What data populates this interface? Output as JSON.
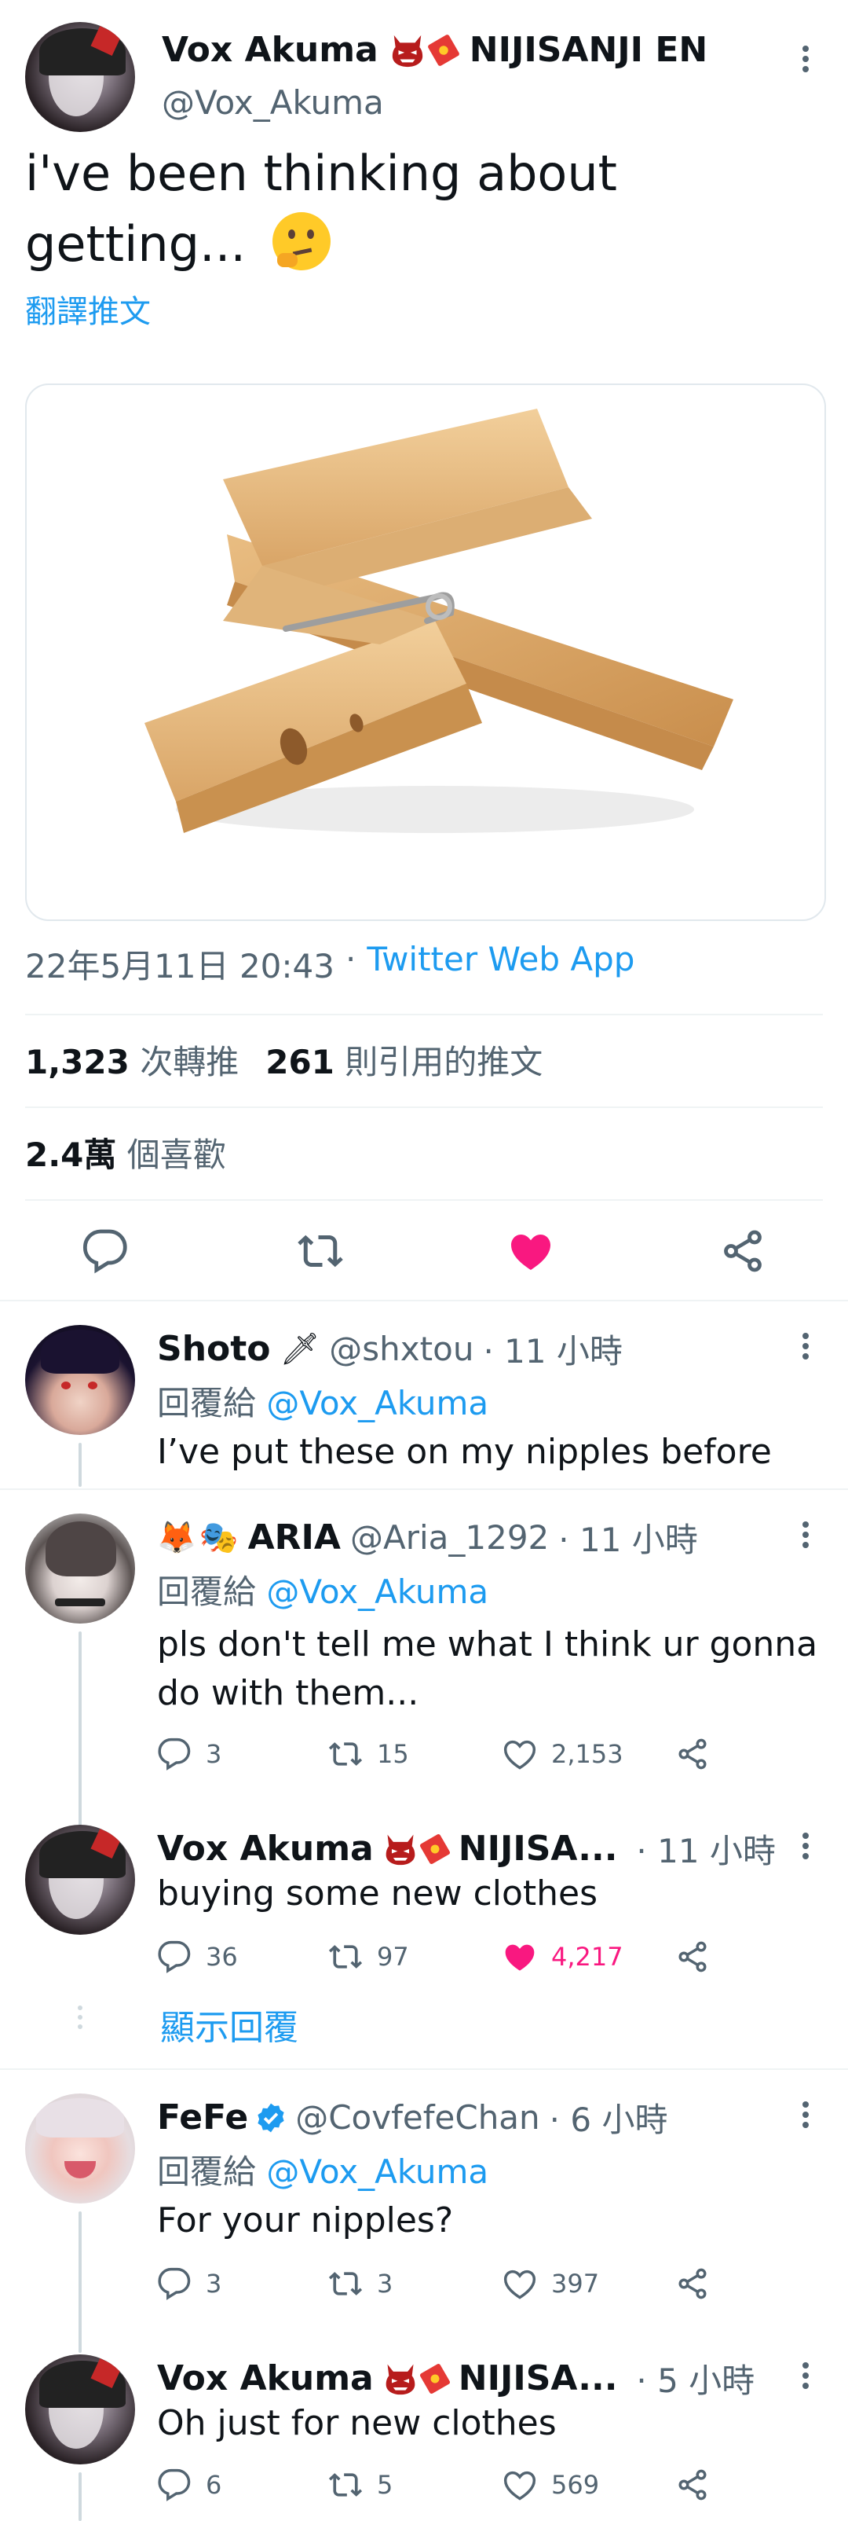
{
  "main_tweet": {
    "display_name": "Vox Akuma",
    "name_suffix": "NIJISANJI EN",
    "handle": "@Vox_Akuma",
    "text": "i've been thinking about getting...",
    "translate_label": "翻譯推文",
    "timestamp": "22年5月11日 20:43",
    "source_separator": "·",
    "source": "Twitter Web App",
    "retweets_count": "1,323",
    "retweets_label": "次轉推",
    "quotes_count": "261",
    "quotes_label": "則引用的推文",
    "likes_count": "2.4萬",
    "likes_label": "個喜歡",
    "liked": true
  },
  "replies": [
    {
      "name": "Shoto",
      "handle": "@shxtou",
      "time": "· 11 小時",
      "reply_prefix": "回覆給",
      "reply_to": "@Vox_Akuma",
      "text": "I’ve put these on my nipples before"
    },
    {
      "name": "ARIA",
      "handle": "@Aria_1292",
      "time": "· 11 小時",
      "reply_prefix": "回覆給",
      "reply_to": "@Vox_Akuma",
      "text_line1": "pls don't tell me what I think ur gonna",
      "text_line2": "do with them...",
      "replies": "3",
      "retweets": "15",
      "likes": "2,153"
    },
    {
      "name": "Vox Akuma",
      "name_suffix": "NIJISA...",
      "time": "· 11 小時",
      "text": "buying some new clothes",
      "replies": "36",
      "retweets": "97",
      "likes": "4,217",
      "liked": true,
      "show_replies": "顯示回覆"
    },
    {
      "name": "FeFe",
      "handle": "@CovfefeChan",
      "time": "· 6 小時",
      "reply_prefix": "回覆給",
      "reply_to": "@Vox_Akuma",
      "text": "For your nipples?",
      "replies": "3",
      "retweets": "3",
      "likes": "397"
    },
    {
      "name": "Vox Akuma",
      "name_suffix": "NIJISA...",
      "time": "· 5 小時",
      "text": "Oh just for new clothes",
      "replies": "6",
      "retweets": "5",
      "likes": "569"
    }
  ],
  "colors": {
    "accent": "#1d9bf0",
    "like": "#f91880",
    "muted": "#536471"
  }
}
